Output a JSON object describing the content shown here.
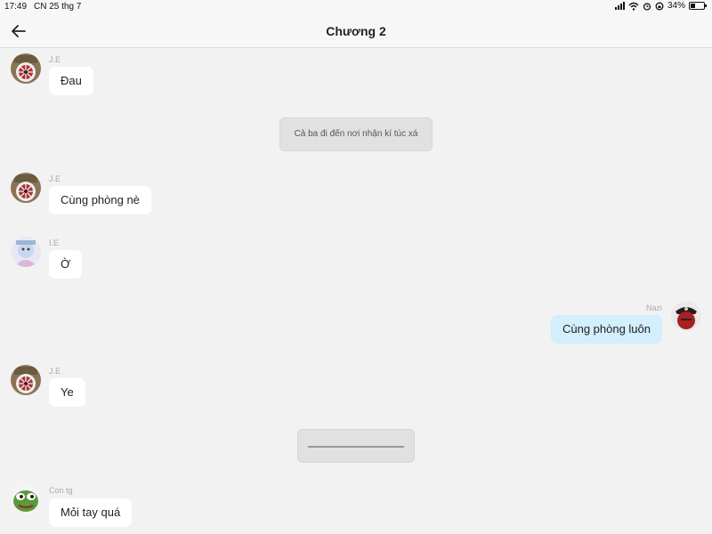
{
  "status_bar": {
    "time": "17:49",
    "date": "CN 25 thg 7",
    "battery": "34%",
    "battery_level": 0.34
  },
  "header": {
    "title": "Chương 2"
  },
  "messages": [
    {
      "sender": "J.E",
      "text": "Đau"
    },
    {
      "narration": "Cả ba đi đến nơi nhận kí túc xá"
    },
    {
      "sender": "J.E",
      "text": "Cùng phòng nè"
    },
    {
      "sender": "I.E",
      "text": "Ờ"
    },
    {
      "sender": "Nazi",
      "text": "Cùng phòng luôn"
    },
    {
      "sender": "J.E",
      "text": "Ye"
    },
    {
      "narration": ""
    },
    {
      "sender": "Con tg",
      "text": "Mỏi tay quá"
    }
  ],
  "icons": {
    "back": "arrow-left-icon",
    "signal": "signal-icon",
    "wifi": "wifi-icon",
    "alarm": "alarm-icon",
    "rotation": "rotation-lock-icon",
    "battery": "battery-icon"
  },
  "colors": {
    "background": "#f2f2f2",
    "bubble": "#ffffff",
    "my_bubble": "#d3eefc",
    "narration": "#e1e1e1"
  }
}
